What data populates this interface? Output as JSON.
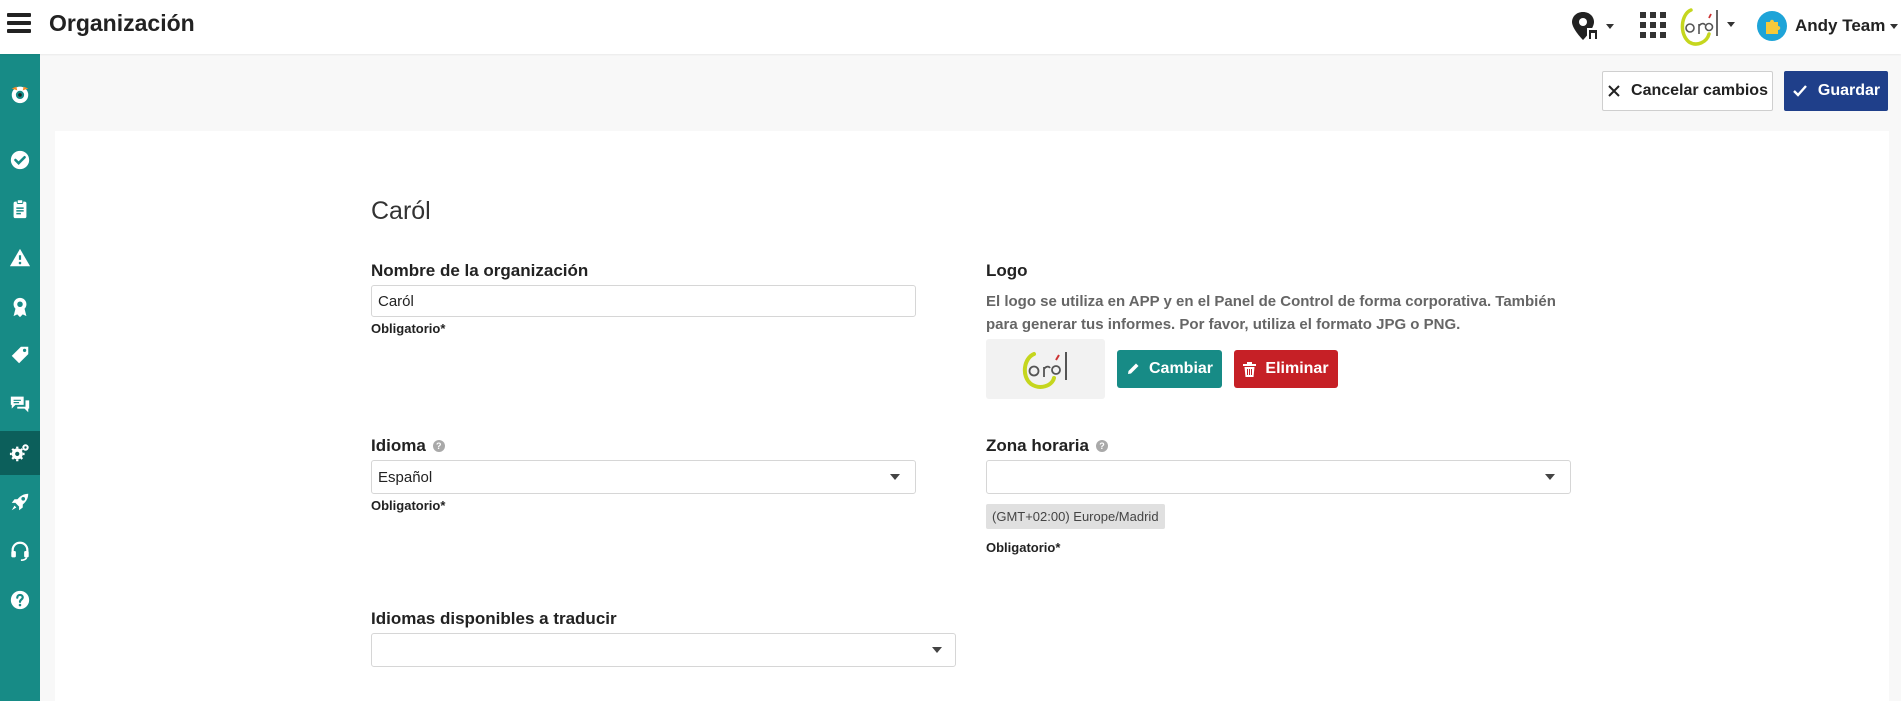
{
  "header": {
    "title": "Organización",
    "user_name": "Andy Team"
  },
  "sidebar": {
    "items": [
      {
        "icon": "mascot-icon"
      },
      {
        "icon": "check-circle-icon"
      },
      {
        "icon": "clipboard-icon"
      },
      {
        "icon": "warning-icon"
      },
      {
        "icon": "award-icon"
      },
      {
        "icon": "tag-icon"
      },
      {
        "icon": "chat-icon"
      },
      {
        "icon": "gears-icon",
        "active": true
      },
      {
        "icon": "rocket-icon"
      },
      {
        "icon": "headset-icon"
      },
      {
        "icon": "help-circle-icon"
      }
    ]
  },
  "actions": {
    "cancel_label": "Cancelar cambios",
    "save_label": "Guardar"
  },
  "form": {
    "section_title": "Caról",
    "org_name": {
      "label": "Nombre de la organización",
      "value": "Caról",
      "required": "Obligatorio*"
    },
    "logo": {
      "label": "Logo",
      "description": "El logo se utiliza en APP y en el Panel de Control de forma corporativa. También para generar tus informes. Por favor, utiliza el formato JPG o PNG.",
      "change_label": "Cambiar",
      "delete_label": "Eliminar"
    },
    "language": {
      "label": "Idioma",
      "value": "Español",
      "required": "Obligatorio*"
    },
    "timezone": {
      "label": "Zona horaria",
      "value": "",
      "tag": "(GMT+02:00) Europe/Madrid",
      "required": "Obligatorio*"
    },
    "translate_languages": {
      "label": "Idiomas disponibles a traducir",
      "value": ""
    }
  },
  "colors": {
    "sidebar": "#178b86",
    "sidebar_active": "#0c5f5b",
    "primary": "#1f3f8a",
    "danger": "#c62026",
    "brand_logo": "#c5d61e"
  }
}
